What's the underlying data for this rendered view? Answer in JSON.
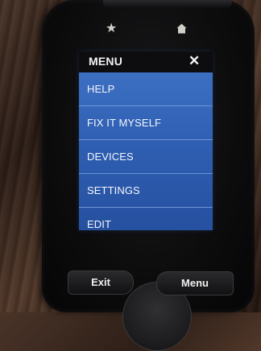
{
  "remote": {
    "top_icons": {
      "left": "star-icon",
      "right": "home-icon"
    },
    "menu": {
      "title": "MENU",
      "close_symbol": "✕",
      "items": [
        {
          "label": "HELP"
        },
        {
          "label": "FIX IT MYSELF"
        },
        {
          "label": "DEVICES"
        },
        {
          "label": "SETTINGS"
        },
        {
          "label": "EDIT"
        }
      ]
    },
    "hardware_buttons": {
      "exit_label": "Exit",
      "menu_label": "Menu"
    },
    "colors": {
      "menu_blue": "#3c6fc2",
      "header_black": "#0d0d10",
      "divider": "#6f95d8"
    }
  }
}
